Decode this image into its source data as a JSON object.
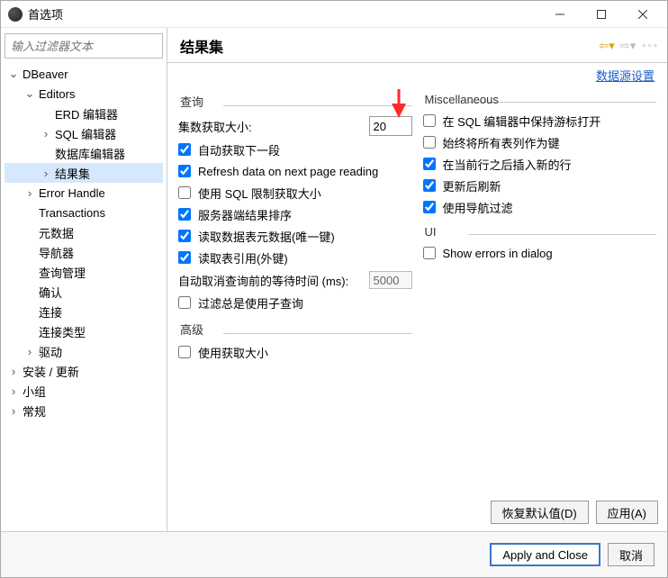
{
  "window": {
    "title": "首选项"
  },
  "sidebar": {
    "filter_placeholder": "输入过滤器文本",
    "items": {
      "dbeaver": "DBeaver",
      "editors": "Editors",
      "erd": "ERD 编辑器",
      "sql": "SQL 编辑器",
      "dbeditor": "数据库编辑器",
      "resultset": "结果集",
      "errhandle": "Error Handle",
      "transactions": "Transactions",
      "metadata": "元数据",
      "navigator": "导航器",
      "querymgr": "查询管理",
      "confirm": "确认",
      "connect": "连接",
      "conntype": "连接类型",
      "driver": "驱动",
      "install": "安装 / 更新",
      "group": "小组",
      "general": "常规"
    }
  },
  "header": {
    "title": "结果集",
    "datasource_link": "数据源设置"
  },
  "query": {
    "group_title": "查询",
    "fetch_size_label": "集数获取大小:",
    "fetch_size_value": "20",
    "auto_fetch_next": "自动获取下一段",
    "refresh_next_page": "Refresh data on next page reading",
    "use_sql_limit": "使用 SQL 限制获取大小",
    "server_side_sort": "服务器端结果排序",
    "read_table_meta": "读取数据表元数据(唯一键)",
    "read_table_ref": "读取表引用(外键)",
    "cancel_wait_label": "自动取消查询前的等待时间 (ms):",
    "cancel_wait_value": "5000",
    "filter_subquery": "过滤总是使用子查询"
  },
  "advanced": {
    "group_title": "高级",
    "use_fetch_size": "使用获取大小"
  },
  "misc": {
    "group_title": "Miscellaneous",
    "keep_cursor": "在 SQL 编辑器中保持游标打开",
    "all_rows_as_key": "始终将所有表列作为键",
    "insert_after_current": "在当前行之后插入新的行",
    "refresh_after_update": "更新后刷新",
    "use_nav_filter": "使用导航过滤"
  },
  "ui": {
    "group_title": "UI",
    "show_errors_dialog": "Show errors in dialog"
  },
  "footer": {
    "restore_defaults": "恢复默认值(D)",
    "apply": "应用(A)",
    "apply_close": "Apply and Close",
    "cancel": "取消"
  }
}
